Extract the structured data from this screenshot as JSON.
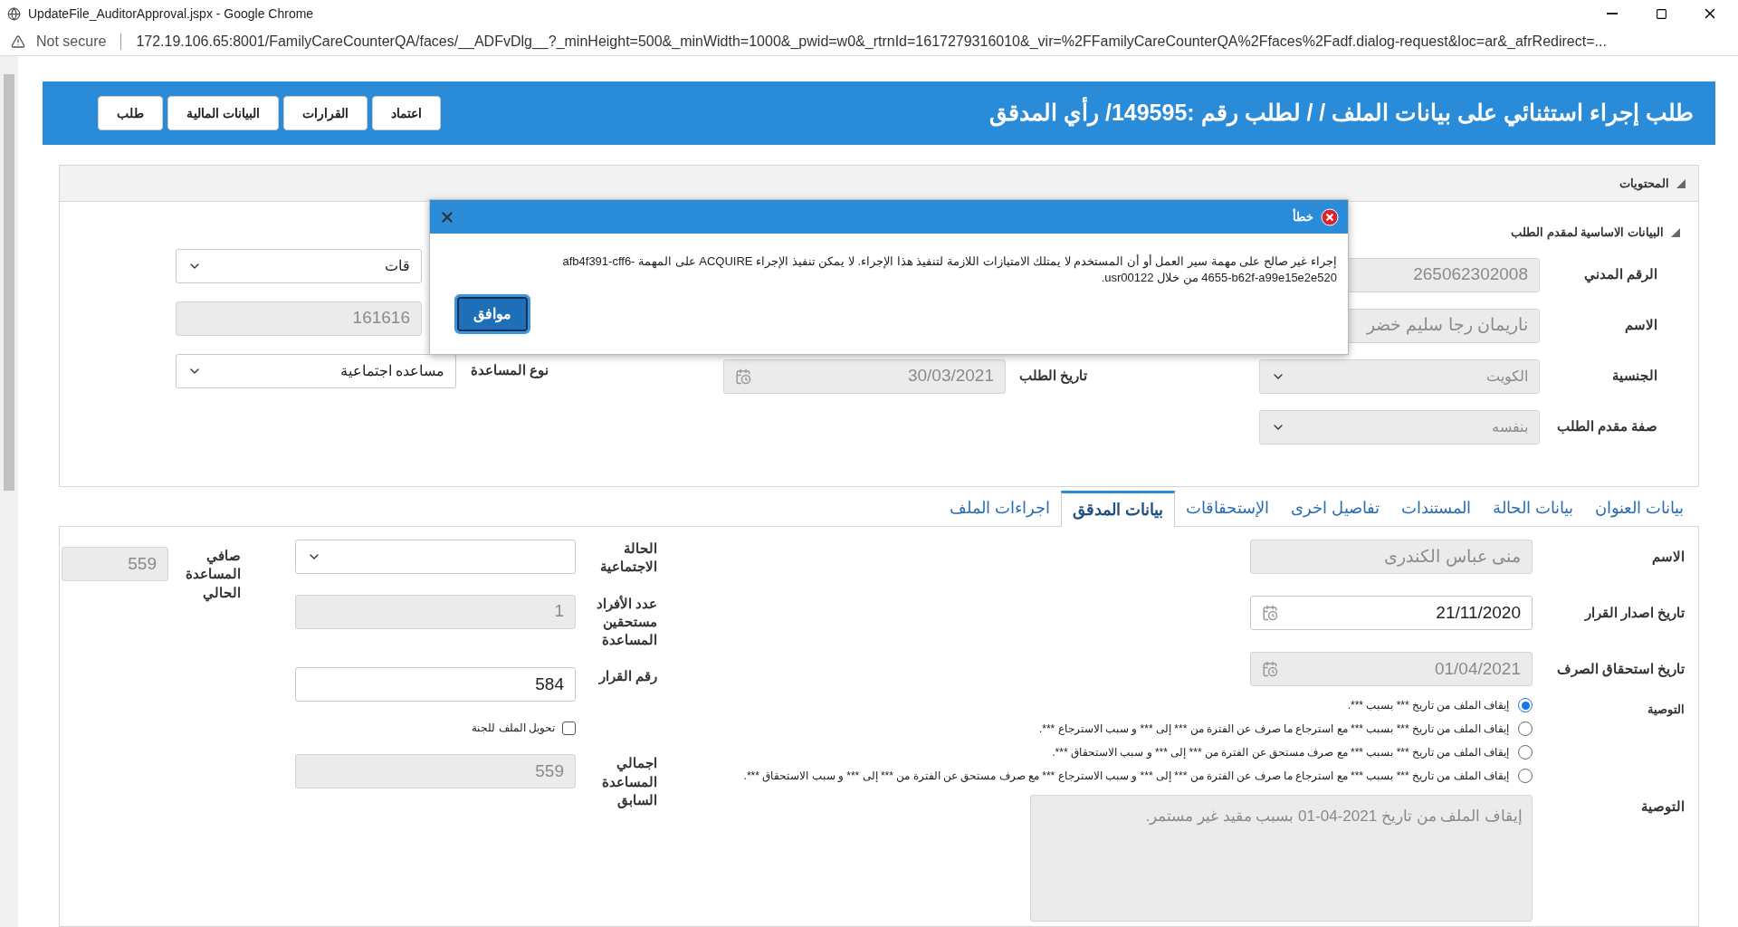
{
  "browser": {
    "title": "UpdateFile_AuditorApproval.jspx - Google Chrome",
    "security_label": "Not secure",
    "url": "172.19.106.65:8001/FamilyCareCounterQA/faces/__ADFvDlg__?_minHeight=500&_minWidth=1000&_pwid=w0&_rtrnId=1617279316010&_vir=%2FFamilyCareCounterQA%2Ffaces%2Fadf.dialog-request&loc=ar&_afrRedirect=..."
  },
  "header": {
    "title": "طلب إجراء استثنائي على بيانات الملف / / لطلب رقم :149595/ رأي المدقق",
    "buttons": [
      "اعتماد",
      "القرارات",
      "البيانات المالية",
      "طلب"
    ]
  },
  "contents": {
    "title": "المحتويات",
    "section_title": "البيانات الاساسية لمقدم الطلب",
    "right_fields": [
      {
        "label": "الرقم المدني",
        "value": "265062302008",
        "kind": "text",
        "disabled": true
      },
      {
        "label": "الاسم",
        "value": "ناريمان رجا سليم خضر",
        "kind": "text",
        "disabled": true
      },
      {
        "label": "الجنسية",
        "value": "الكويت",
        "kind": "select",
        "disabled": true
      },
      {
        "label": "صفة مقدم الطلب",
        "value": "بنفسه",
        "kind": "select",
        "disabled": true
      }
    ],
    "middle_fields": [
      {
        "label": "تاريخ الطلب",
        "value": "30/03/2021",
        "kind": "date",
        "disabled": true
      }
    ],
    "left_fields": [
      {
        "value": "قات",
        "kind": "select",
        "disabled": false
      },
      {
        "value": "161616",
        "kind": "text",
        "disabled": true
      },
      {
        "label": "نوع المساعدة",
        "value": "مساعده اجتماعية",
        "kind": "select",
        "disabled": false
      }
    ]
  },
  "tabs": [
    {
      "label": "بيانات العنوان",
      "selected": false
    },
    {
      "label": "بيانات الحالة",
      "selected": false
    },
    {
      "label": "المستندات",
      "selected": false
    },
    {
      "label": "تفاصيل اخرى",
      "selected": false
    },
    {
      "label": "الإستحقاقات",
      "selected": false
    },
    {
      "label": "بيانات المدقق",
      "selected": true
    },
    {
      "label": "اجراءات الملف",
      "selected": false
    }
  ],
  "auditor": {
    "right_fields": [
      {
        "label": "الاسم",
        "value": "منى عباس الكندرى",
        "kind": "text",
        "disabled": true
      },
      {
        "label": "تاريخ اصدار القرار",
        "value": "21/11/2020",
        "kind": "date",
        "disabled": false
      },
      {
        "label": "تاريخ استحقاق الصرف",
        "value": "01/04/2021",
        "kind": "date",
        "disabled": true
      }
    ],
    "recommendation_label": "التوصية",
    "recommendation_options": [
      {
        "text": "إيقاف الملف من تاريخ *** بسبب ***.",
        "selected": true
      },
      {
        "text": "إيقاف الملف من تاريخ *** بسبب *** مع استرجاع ما صرف عن الفترة من *** إلى *** و سبب الاسترجاع ***.",
        "selected": false
      },
      {
        "text": "إيقاف الملف من تاريخ *** بسبب *** مع صرف مستحق عن الفترة من *** إلى *** و سبب الاستحقاق ***.",
        "selected": false
      },
      {
        "text": "إيقاف الملف من تاريخ *** بسبب *** مع استرجاع ما صرف عن الفترة من *** إلى *** و سبب الاسترجاع *** مع صرف مستحق عن الفترة من *** إلى *** و سبب الاستحقاق ***.",
        "selected": false
      }
    ],
    "recommendation_text": {
      "label": "التوصية",
      "value": "إيقاف الملف من تاريخ 2021-04-01  بسبب مقيد غير مستمر.",
      "disabled": true
    },
    "middle_fields": [
      {
        "label": "الحالة الاجتماعية",
        "kind": "select",
        "disabled": false
      },
      {
        "label": "عدد الأفراد مستحقين المساعدة",
        "value": "1",
        "kind": "text",
        "disabled": true
      },
      {
        "label": "رقم القرار",
        "value": "584",
        "kind": "text",
        "disabled": false
      },
      {
        "label": "تحويل الملف للجنة",
        "kind": "checkbox",
        "checked": false
      },
      {
        "label": "اجمالي المساعدة السابق",
        "value": "559",
        "kind": "text",
        "disabled": true
      }
    ],
    "left_fields": [
      {
        "label": "صافي المساعدة الحالي",
        "value": "559",
        "kind": "text",
        "disabled": true
      }
    ]
  },
  "dialog": {
    "title": "خطأ",
    "message": "إجراء غير صالح على مهمة سير العمل أو أن المستخدم لا يمتلك الامتيازات اللازمة لتنفيذ هذا الإجراء. لا يمكن تنفيذ الإجراء ACQUIRE على المهمة afb4f391-cff6-4655-b62f-a99e15e2e520 من خلال usr00122.",
    "button": "موافق"
  }
}
